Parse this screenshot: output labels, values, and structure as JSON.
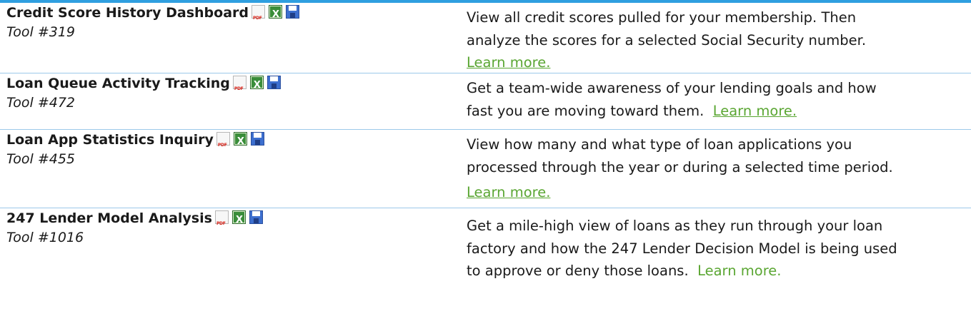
{
  "colors": {
    "accent_bar": "#2f9fe0",
    "divider": "#9cc9ea",
    "link": "#5aa632"
  },
  "icons": [
    "pdf-icon",
    "excel-icon",
    "save-icon"
  ],
  "pdf_icon_text": "PDF",
  "tools": [
    {
      "name": "Credit Score History Dashboard",
      "tool_number": "Tool #319",
      "desc_lines": [
        "View all credit scores pulled for your membership.  Then",
        "analyze the scores for a selected Social Security number."
      ],
      "learn_more": "Learn more."
    },
    {
      "name": "Loan Queue Activity Tracking",
      "tool_number": "Tool #472",
      "desc_lines": [
        "Get a team-wide awareness of your lending goals and how",
        "fast you are moving toward them.  "
      ],
      "learn_more": "Learn more."
    },
    {
      "name": "Loan App Statistics Inquiry",
      "tool_number": "Tool #455",
      "desc_lines": [
        "View how many and what type of loan applications you",
        "processed through the year or during a selected time period."
      ],
      "learn_more": "Learn more."
    },
    {
      "name": "247 Lender Model Analysis",
      "tool_number": "Tool #1016",
      "desc_lines": [
        "Get a mile-high view of loans as they run through your loan",
        "factory and how the 247 Lender Decision Model is being used",
        "to approve or deny those loans.  "
      ],
      "learn_more": "Learn more."
    }
  ]
}
